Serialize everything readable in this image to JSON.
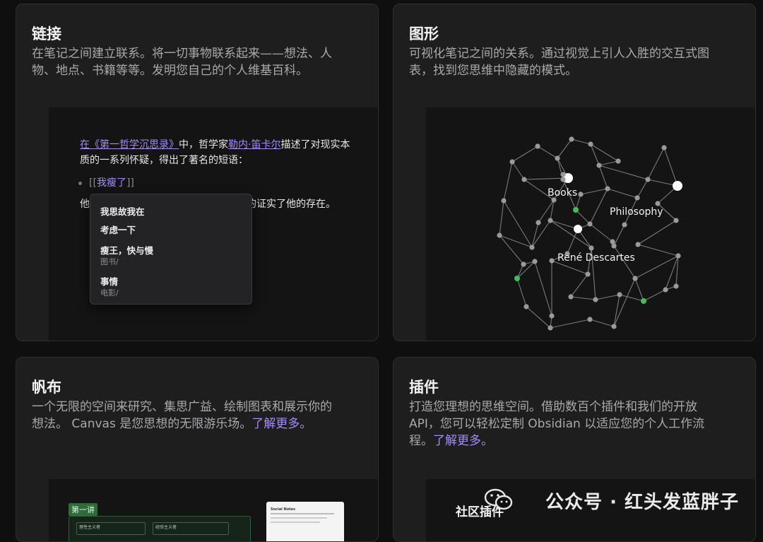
{
  "links": {
    "title": "链接",
    "desc_line1": "在笔记之间建立联系。将一切事物联系起来——想法、人",
    "desc_line2": "物、地点、书籍等等。发明您自己的个人维基百科。",
    "editor": {
      "line1_link1": "在《第一哲学沉思录》",
      "line1_mid": "中，哲学家",
      "line1_link2": "勒内·笛卡尔",
      "line1_end": "描述了对现实本",
      "line2": "质的一系列怀疑，得出了著名的短语：",
      "bullet_open": "[[",
      "bullet_link": "我瘦了",
      "bullet_close": "]]",
      "line4_start": "他",
      "line4_end": "的证实了他的存在。"
    },
    "popup": [
      {
        "label": "我思故我在",
        "sub": ""
      },
      {
        "label": "考虑一下",
        "sub": ""
      },
      {
        "label": "瘦王，快与慢",
        "sub": "图书/"
      },
      {
        "label": "事情",
        "sub": "电影/"
      }
    ]
  },
  "graph": {
    "title": "图形",
    "desc_line1": "可视化笔记之间的关系。通过视觉上引人入胜的交互式图",
    "desc_line2": "表，找到您思维中隐藏的模式。",
    "labels": [
      "Books",
      "Philosophy",
      "René Descartes"
    ]
  },
  "canvas": {
    "title": "帆布",
    "desc_line1": "一个无限的空间来研究、集思广益、绘制图表和展示你的",
    "desc_line2_text": "想法。 Canvas 是您思想的无限游乐场。",
    "desc_link": "了解更多。",
    "tag": "第一讲",
    "box1": "理性主义者",
    "box2": "经验主义者",
    "mini_title": "Social Notes"
  },
  "plugins": {
    "title": "插件",
    "desc_line1": "打造您理想的思维空间。借助数百个插件和我们的开放",
    "desc_line2": "API，您可以轻松定制 Obsidian 以适应您的个人工作流",
    "desc_line3_text": "程。",
    "desc_link": "了解更多。",
    "community": "社区插件"
  },
  "watermark": "公众号 · 红头发蓝胖子"
}
